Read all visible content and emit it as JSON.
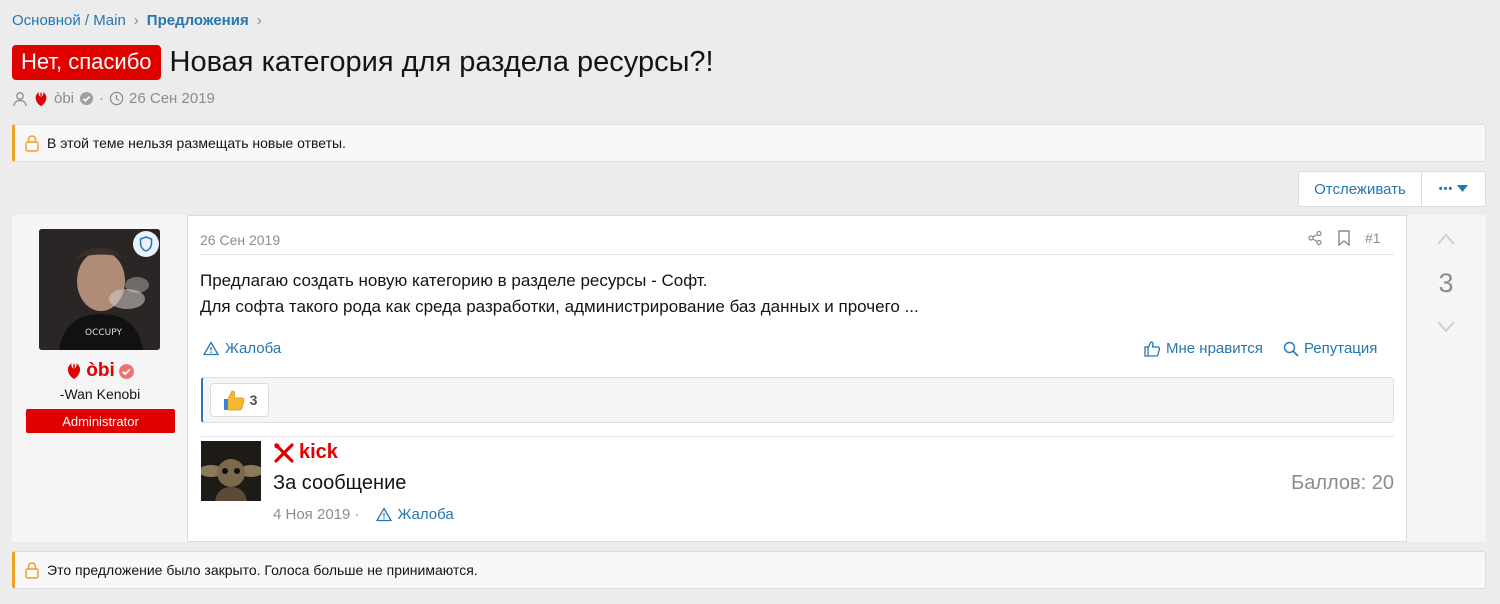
{
  "breadcrumb": {
    "root": "Основной / Main",
    "current": "Предложения"
  },
  "thread": {
    "prefix": "Нет, спасибо",
    "title": "Новая категория для раздела ресурсы?!",
    "author": "òbi",
    "date": "26 Сен 2019"
  },
  "notices": {
    "locked": "В этой теме нельзя размещать новые ответы.",
    "closed": "Это предложение было закрыто. Голоса больше не принимаются."
  },
  "buttons": {
    "watch": "Отслеживать",
    "more": "•••"
  },
  "post": {
    "user": {
      "name": "òbi",
      "title": "-Wan Kenobi",
      "role": "Administrator"
    },
    "date": "26 Сен 2019",
    "number": "#1",
    "body_line1": "Предлагаю создать новую категорию в разделе ресурсы - Софт.",
    "body_line2": "Для софта такого рода как среда разработки, администрирование баз данных и прочего ...",
    "report": "Жалоба",
    "like": "Мне нравится",
    "reputation": "Репутация",
    "reaction_count": "3",
    "votes": "3"
  },
  "rep_entry": {
    "user": "kick",
    "text": "За сообщение",
    "date": "4 Ноя 2019 ·",
    "report": "Жалоба",
    "points": "Баллов: 20"
  },
  "colors": {
    "accent": "#2577b1",
    "prefix": "#e00000",
    "notice_border": "#f0a020"
  }
}
